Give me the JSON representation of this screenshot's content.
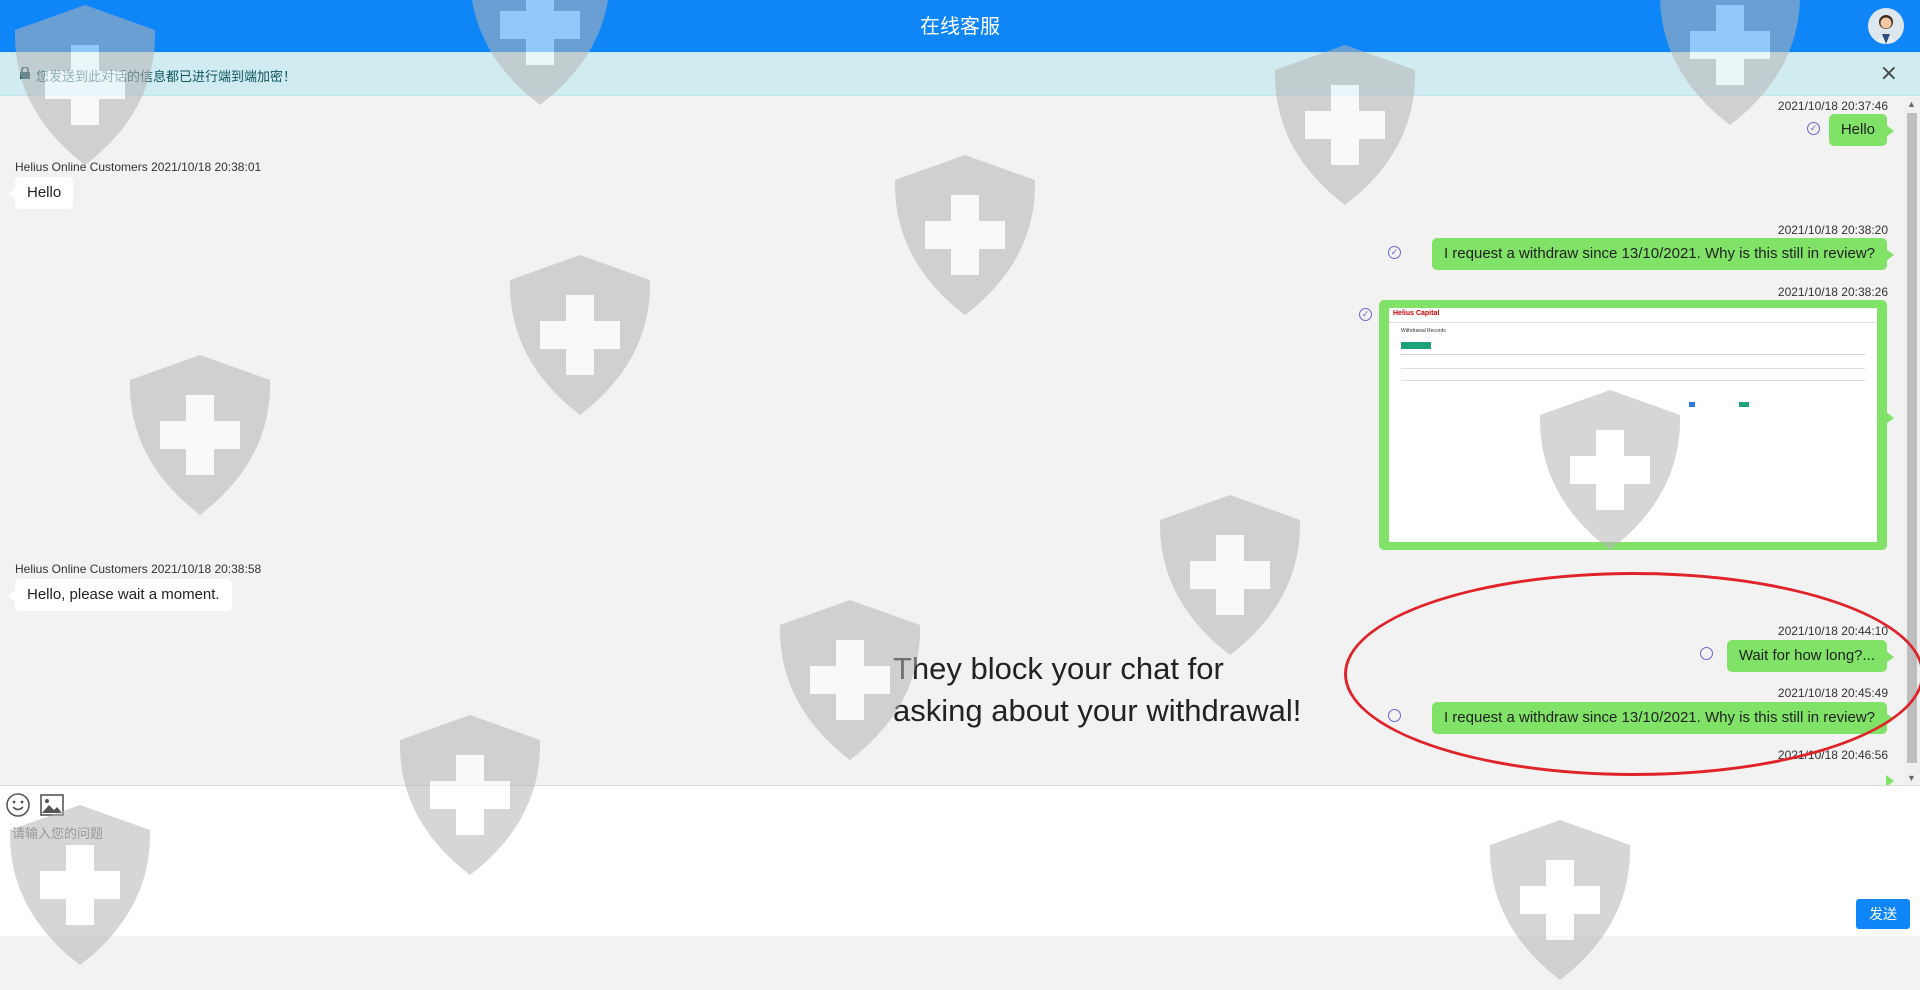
{
  "header": {
    "title": "在线客服"
  },
  "notice": {
    "text": "您发送到此对话的信息都已进行端到端加密！",
    "close": "×"
  },
  "messages": [
    {
      "side": "me",
      "time": "2021/10/18 20:37:46",
      "text": "Hello",
      "status": "read"
    },
    {
      "side": "them",
      "sender": "Helius Online Customers",
      "time": "2021/10/18 20:38:01",
      "text": "Hello"
    },
    {
      "side": "me",
      "time": "2021/10/18 20:38:20",
      "text": "I request a withdraw since 13/10/2021. Why is this still in review?",
      "status": "read"
    },
    {
      "side": "me",
      "time": "2021/10/18 20:38:26",
      "image": true,
      "status": "read"
    },
    {
      "side": "them",
      "sender": "Helius Online Customers",
      "time": "2021/10/18 20:38:58",
      "text": "Hello, please wait a moment."
    },
    {
      "side": "me",
      "time": "2021/10/18 20:44:10",
      "text": "Wait for how long?...",
      "status": "unread"
    },
    {
      "side": "me",
      "time": "2021/10/18 20:45:49",
      "text": "I request a withdraw since 13/10/2021. Why is this still in review?",
      "status": "unread"
    },
    {
      "side": "me",
      "time": "2021/10/18 20:46:56",
      "text": "",
      "status": "unread"
    }
  ],
  "screenshot": {
    "brand": "Helius Capital",
    "title": "Withdrawal Records"
  },
  "annotation": {
    "line1": "They block your chat for",
    "line2": "asking about your withdrawal!"
  },
  "composer": {
    "placeholder": "请输入您的问题",
    "send_label": "发送"
  },
  "colors": {
    "header": "#0f86f8",
    "my_bubble": "#80e266",
    "their_bubble": "#ffffff",
    "annotation_ring": "#e0232a"
  }
}
